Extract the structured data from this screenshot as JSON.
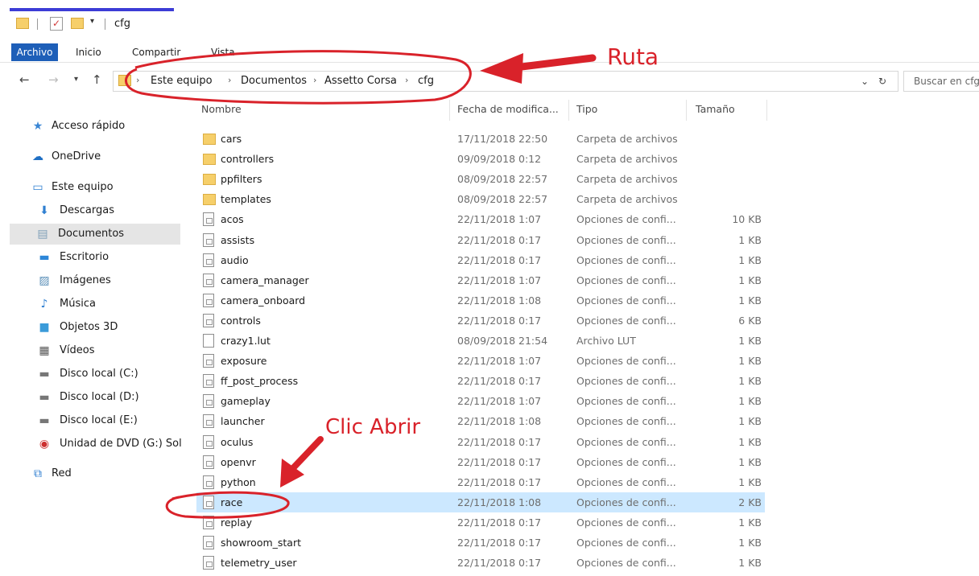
{
  "window": {
    "title": "cfg"
  },
  "ribbon": {
    "tabs": [
      "Archivo",
      "Inicio",
      "Compartir",
      "Vista"
    ]
  },
  "address": {
    "crumbs": [
      "Este equipo",
      "Documentos",
      "Assetto Corsa",
      "cfg"
    ],
    "search_placeholder": "Buscar en cfg"
  },
  "sidebar": {
    "items": [
      {
        "label": "Acceso rápido",
        "icon": "star-icon"
      },
      {
        "label": "OneDrive",
        "icon": "cloud-icon"
      },
      {
        "label": "Este equipo",
        "icon": "computer-icon"
      },
      {
        "label": "Descargas",
        "icon": "download-icon"
      },
      {
        "label": "Documentos",
        "icon": "document-icon",
        "selected": true
      },
      {
        "label": "Escritorio",
        "icon": "desktop-icon"
      },
      {
        "label": "Imágenes",
        "icon": "image-icon"
      },
      {
        "label": "Música",
        "icon": "music-icon"
      },
      {
        "label": "Objetos 3D",
        "icon": "cube-icon"
      },
      {
        "label": "Vídeos",
        "icon": "video-icon"
      },
      {
        "label": "Disco local (C:)",
        "icon": "drive-icon"
      },
      {
        "label": "Disco local (D:)",
        "icon": "drive-icon"
      },
      {
        "label": "Disco local (E:)",
        "icon": "drive-icon"
      },
      {
        "label": "Unidad de DVD (G:) Sol",
        "icon": "dvd-icon"
      },
      {
        "label": "Red",
        "icon": "network-icon"
      }
    ]
  },
  "columns": {
    "name": "Nombre",
    "date": "Fecha de modifica...",
    "type": "Tipo",
    "size": "Tamaño"
  },
  "files": [
    {
      "name": "cars",
      "date": "17/11/2018 22:50",
      "type": "Carpeta de archivos",
      "size": "",
      "kind": "folder"
    },
    {
      "name": "controllers",
      "date": "09/09/2018 0:12",
      "type": "Carpeta de archivos",
      "size": "",
      "kind": "folder"
    },
    {
      "name": "ppfilters",
      "date": "08/09/2018 22:57",
      "type": "Carpeta de archivos",
      "size": "",
      "kind": "folder"
    },
    {
      "name": "templates",
      "date": "08/09/2018 22:57",
      "type": "Carpeta de archivos",
      "size": "",
      "kind": "folder"
    },
    {
      "name": "acos",
      "date": "22/11/2018 1:07",
      "type": "Opciones de confi...",
      "size": "10 KB",
      "kind": "cfg"
    },
    {
      "name": "assists",
      "date": "22/11/2018 0:17",
      "type": "Opciones de confi...",
      "size": "1 KB",
      "kind": "cfg"
    },
    {
      "name": "audio",
      "date": "22/11/2018 0:17",
      "type": "Opciones de confi...",
      "size": "1 KB",
      "kind": "cfg"
    },
    {
      "name": "camera_manager",
      "date": "22/11/2018 1:07",
      "type": "Opciones de confi...",
      "size": "1 KB",
      "kind": "cfg"
    },
    {
      "name": "camera_onboard",
      "date": "22/11/2018 1:08",
      "type": "Opciones de confi...",
      "size": "1 KB",
      "kind": "cfg"
    },
    {
      "name": "controls",
      "date": "22/11/2018 0:17",
      "type": "Opciones de confi...",
      "size": "6 KB",
      "kind": "cfg"
    },
    {
      "name": "crazy1.lut",
      "date": "08/09/2018 21:54",
      "type": "Archivo LUT",
      "size": "1 KB",
      "kind": "plain"
    },
    {
      "name": "exposure",
      "date": "22/11/2018 1:07",
      "type": "Opciones de confi...",
      "size": "1 KB",
      "kind": "cfg"
    },
    {
      "name": "ff_post_process",
      "date": "22/11/2018 0:17",
      "type": "Opciones de confi...",
      "size": "1 KB",
      "kind": "cfg"
    },
    {
      "name": "gameplay",
      "date": "22/11/2018 1:07",
      "type": "Opciones de confi...",
      "size": "1 KB",
      "kind": "cfg"
    },
    {
      "name": "launcher",
      "date": "22/11/2018 1:08",
      "type": "Opciones de confi...",
      "size": "1 KB",
      "kind": "cfg"
    },
    {
      "name": "oculus",
      "date": "22/11/2018 0:17",
      "type": "Opciones de confi...",
      "size": "1 KB",
      "kind": "cfg"
    },
    {
      "name": "openvr",
      "date": "22/11/2018 0:17",
      "type": "Opciones de confi...",
      "size": "1 KB",
      "kind": "cfg"
    },
    {
      "name": "python",
      "date": "22/11/2018 0:17",
      "type": "Opciones de confi...",
      "size": "1 KB",
      "kind": "cfg"
    },
    {
      "name": "race",
      "date": "22/11/2018 1:08",
      "type": "Opciones de confi...",
      "size": "2 KB",
      "kind": "cfg",
      "selected": true
    },
    {
      "name": "replay",
      "date": "22/11/2018 0:17",
      "type": "Opciones de confi...",
      "size": "1 KB",
      "kind": "cfg"
    },
    {
      "name": "showroom_start",
      "date": "22/11/2018 0:17",
      "type": "Opciones de confi...",
      "size": "1 KB",
      "kind": "cfg"
    },
    {
      "name": "telemetry_user",
      "date": "22/11/2018 0:17",
      "type": "Opciones de confi...",
      "size": "1 KB",
      "kind": "cfg"
    }
  ],
  "annotations": {
    "path_label": "Ruta",
    "open_label": "Clic Abrir",
    "color": "#d9222a"
  },
  "colors": {
    "file_tab": "#1e5fb8",
    "selected_row": "#cce8ff",
    "folder": "#f6cf6a"
  }
}
